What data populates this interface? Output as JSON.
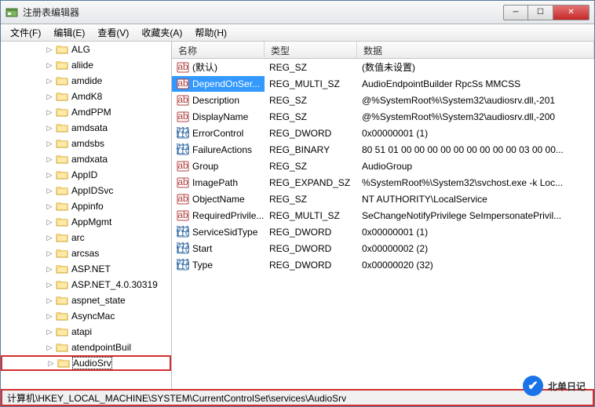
{
  "window": {
    "title": "注册表编辑器"
  },
  "menus": {
    "file": "文件(F)",
    "edit": "编辑(E)",
    "view": "查看(V)",
    "favorites": "收藏夹(A)",
    "help": "帮助(H)"
  },
  "tree": {
    "items": [
      {
        "label": "ALG"
      },
      {
        "label": "aliide"
      },
      {
        "label": "amdide"
      },
      {
        "label": "AmdK8"
      },
      {
        "label": "AmdPPM"
      },
      {
        "label": "amdsata"
      },
      {
        "label": "amdsbs"
      },
      {
        "label": "amdxata"
      },
      {
        "label": "AppID"
      },
      {
        "label": "AppIDSvc"
      },
      {
        "label": "Appinfo"
      },
      {
        "label": "AppMgmt"
      },
      {
        "label": "arc"
      },
      {
        "label": "arcsas"
      },
      {
        "label": "ASP.NET"
      },
      {
        "label": "ASP.NET_4.0.30319"
      },
      {
        "label": "aspnet_state"
      },
      {
        "label": "AsyncMac"
      },
      {
        "label": "atapi"
      },
      {
        "label": "atendpointBuil"
      },
      {
        "label": "AudioSrv",
        "selected": true,
        "highlighted": true
      }
    ]
  },
  "list": {
    "headers": {
      "name": "名称",
      "type": "类型",
      "data": "数据"
    },
    "rows": [
      {
        "icon": "sz",
        "name": "(默认)",
        "type": "REG_SZ",
        "data": "(数值未设置)"
      },
      {
        "icon": "sz",
        "name": "DependOnSer...",
        "type": "REG_MULTI_SZ",
        "data": "AudioEndpointBuilder RpcSs MMCSS",
        "selected": true
      },
      {
        "icon": "sz",
        "name": "Description",
        "type": "REG_SZ",
        "data": "@%SystemRoot%\\System32\\audiosrv.dll,-201"
      },
      {
        "icon": "sz",
        "name": "DisplayName",
        "type": "REG_SZ",
        "data": "@%SystemRoot%\\System32\\audiosrv.dll,-200"
      },
      {
        "icon": "bin",
        "name": "ErrorControl",
        "type": "REG_DWORD",
        "data": "0x00000001 (1)"
      },
      {
        "icon": "bin",
        "name": "FailureActions",
        "type": "REG_BINARY",
        "data": "80 51 01 00 00 00 00 00 00 00 00 00 03 00 00..."
      },
      {
        "icon": "sz",
        "name": "Group",
        "type": "REG_SZ",
        "data": "AudioGroup"
      },
      {
        "icon": "sz",
        "name": "ImagePath",
        "type": "REG_EXPAND_SZ",
        "data": "%SystemRoot%\\System32\\svchost.exe -k Loc..."
      },
      {
        "icon": "sz",
        "name": "ObjectName",
        "type": "REG_SZ",
        "data": "NT AUTHORITY\\LocalService"
      },
      {
        "icon": "sz",
        "name": "RequiredPrivile...",
        "type": "REG_MULTI_SZ",
        "data": "SeChangeNotifyPrivilege SeImpersonatePrivil..."
      },
      {
        "icon": "bin",
        "name": "ServiceSidType",
        "type": "REG_DWORD",
        "data": "0x00000001 (1)"
      },
      {
        "icon": "bin",
        "name": "Start",
        "type": "REG_DWORD",
        "data": "0x00000002 (2)"
      },
      {
        "icon": "bin",
        "name": "Type",
        "type": "REG_DWORD",
        "data": "0x00000020 (32)"
      }
    ]
  },
  "statusbar": {
    "path": "计算机\\HKEY_LOCAL_MACHINE\\SYSTEM\\CurrentControlSet\\services\\AudioSrv"
  },
  "watermark": {
    "text": "北单日记"
  }
}
